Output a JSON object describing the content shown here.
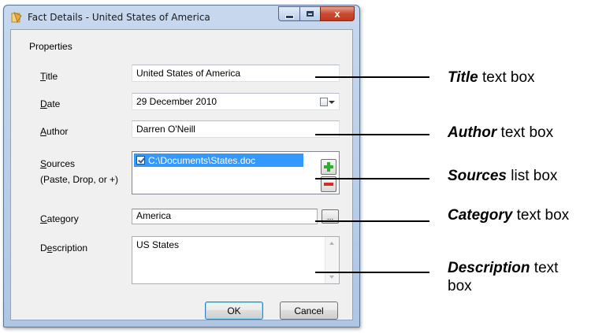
{
  "window": {
    "title": "Fact Details - United States of America",
    "controls": {
      "minimize": "minimize",
      "maximize": "maximize",
      "close": "x"
    }
  },
  "group": {
    "label": "Properties"
  },
  "fields": {
    "title": {
      "label_mnemonic": "T",
      "label_rest": "itle",
      "value": "United States of America"
    },
    "date": {
      "label_mnemonic": "D",
      "label_rest": "ate",
      "value": "29 December 2010"
    },
    "author": {
      "label_mnemonic": "A",
      "label_rest": "uthor",
      "value": "Darren O'Neill"
    },
    "sources": {
      "label_mnemonic": "S",
      "label_rest": "ources",
      "hint": "(Paste, Drop, or +)",
      "items": [
        {
          "path": "C:\\Documents\\States.doc",
          "checked": true
        }
      ]
    },
    "category": {
      "label_mnemonic": "C",
      "label_rest": "ategory",
      "value": "America",
      "browse_label": "..."
    },
    "description": {
      "label_pre": "D",
      "label_mnemonic": "e",
      "label_rest": "scription",
      "value": "US States"
    }
  },
  "buttons": {
    "ok": "OK",
    "cancel": "Cancel"
  },
  "annotations": [
    {
      "bold": "Title",
      "rest": " text box"
    },
    {
      "bold": "Author",
      "rest": " text box"
    },
    {
      "bold": "Sources",
      "rest": " list box"
    },
    {
      "bold": "Category",
      "rest": " text box"
    },
    {
      "bold": "Description",
      "rest": " text",
      "line2": "box"
    }
  ],
  "colors": {
    "selection": "#3399ff",
    "add": "#2eae2e",
    "remove": "#d42b2b",
    "close": "#c74a31"
  }
}
